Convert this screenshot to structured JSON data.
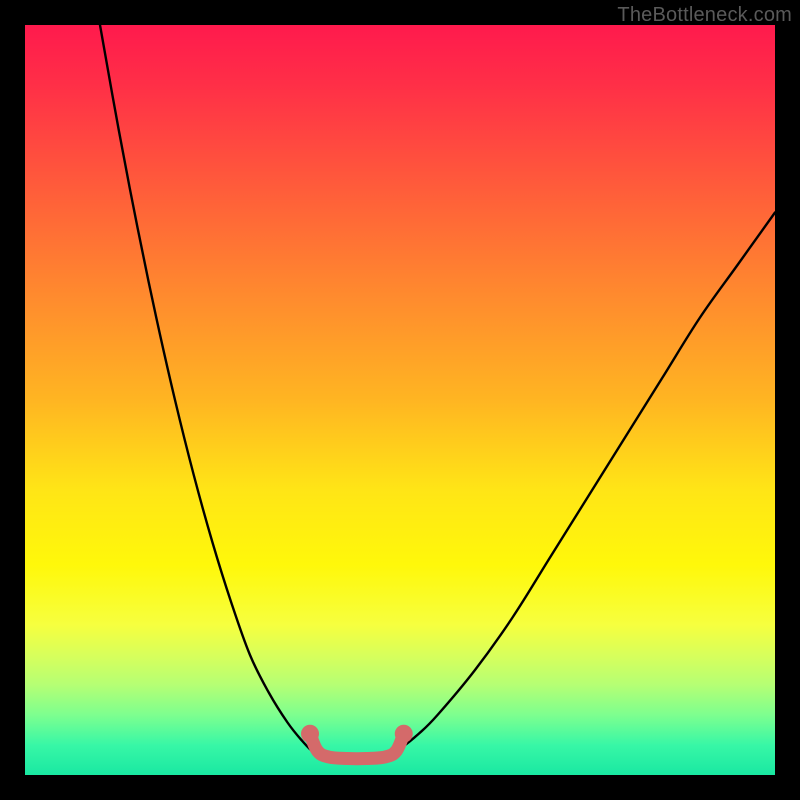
{
  "watermark": "TheBottleneck.com",
  "chart_data": {
    "type": "line",
    "title": "",
    "xlabel": "",
    "ylabel": "",
    "xlim": [
      0,
      100
    ],
    "ylim": [
      0,
      100
    ],
    "series": [
      {
        "name": "left-curve",
        "x": [
          10.0,
          12.5,
          15.0,
          17.5,
          20.0,
          22.5,
          25.0,
          27.5,
          30.0,
          32.5,
          35.0,
          37.0,
          38.5,
          39.5
        ],
        "y": [
          100.0,
          86.0,
          73.0,
          61.0,
          50.0,
          40.0,
          31.0,
          23.0,
          16.0,
          11.0,
          7.0,
          4.5,
          3.0,
          2.7
        ]
      },
      {
        "name": "right-curve",
        "x": [
          48.5,
          50.0,
          52.5,
          55.0,
          60.0,
          65.0,
          70.0,
          75.0,
          80.0,
          85.0,
          90.0,
          95.0,
          100.0
        ],
        "y": [
          2.7,
          3.5,
          5.5,
          8.0,
          14.0,
          21.0,
          29.0,
          37.0,
          45.0,
          53.0,
          61.0,
          68.0,
          75.0
        ]
      },
      {
        "name": "highlight-band",
        "x": [
          38.0,
          39.0,
          40.5,
          43.0,
          45.5,
          48.0,
          49.5,
          50.5
        ],
        "y": [
          5.5,
          3.2,
          2.4,
          2.2,
          2.2,
          2.4,
          3.2,
          5.5
        ]
      }
    ],
    "annotations": []
  },
  "colors": {
    "curve": "#000000",
    "highlight": "#d46a6a",
    "background_top": "#ff1a4d",
    "background_bottom": "#19e8a2"
  }
}
